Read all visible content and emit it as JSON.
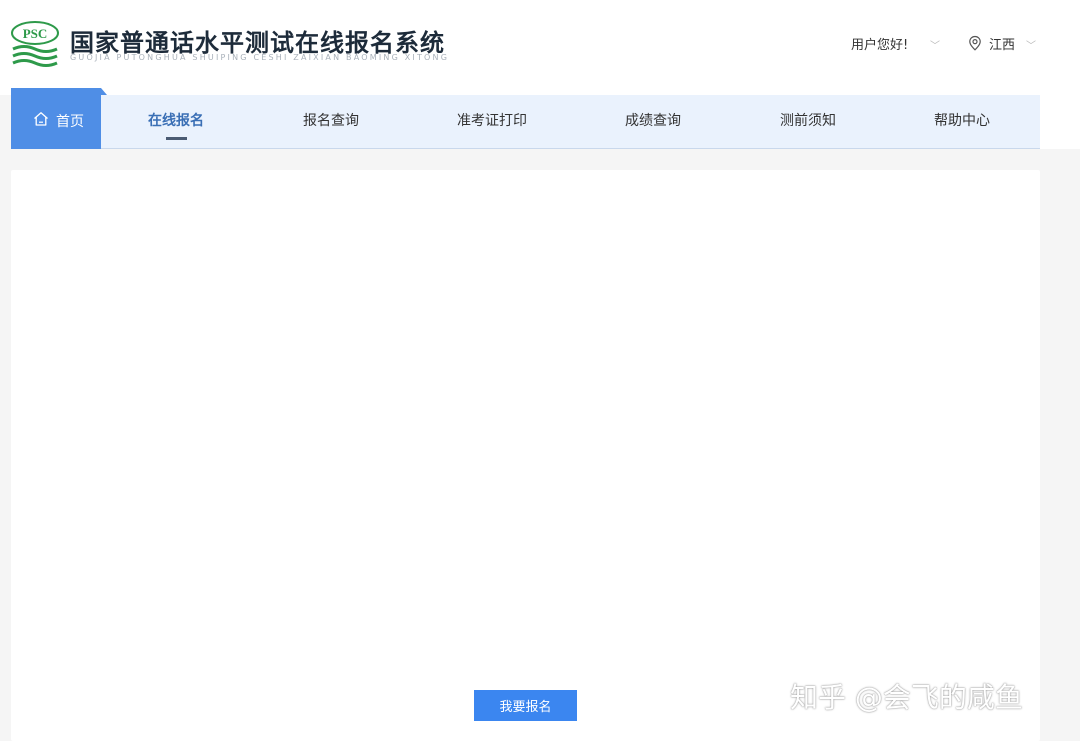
{
  "header": {
    "logo_text": "PSC",
    "title": "国家普通话水平测试在线报名系统",
    "subtitle": "GUOJIA PUTONGHUA SHUIPING CESHI ZAIXIAN BAOMING XITONG",
    "greeting": "用户您好!",
    "location": "江西"
  },
  "nav": {
    "home": "首页",
    "items": [
      "在线报名",
      "报名查询",
      "准考证打印",
      "成绩查询",
      "测前须知",
      "帮助中心"
    ],
    "active_index": 0
  },
  "content": {
    "signup_button": "我要报名"
  },
  "watermark": "知乎 @会飞的咸鱼",
  "colors": {
    "accent": "#3b86f0",
    "home_tab": "#4f8ee6",
    "nav_bg": "#eaf2fd",
    "active_text": "#3a6fb5",
    "logo_green": "#2e9a4a"
  }
}
